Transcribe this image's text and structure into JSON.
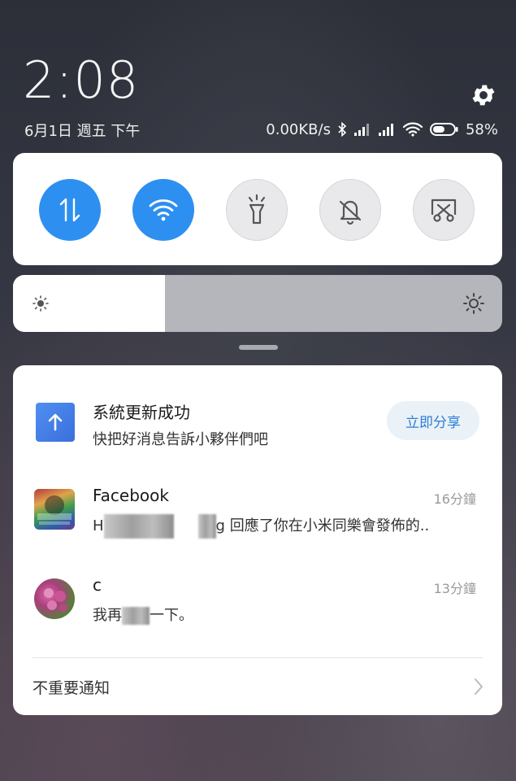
{
  "clock": {
    "time": "2:08",
    "date": "6月1日 週五 下午"
  },
  "status_bar": {
    "net_speed": "0.00KB/s",
    "battery_percent": "58%",
    "battery_level": 0.58,
    "icons": [
      "bluetooth-icon",
      "signal-icon",
      "signal-icon",
      "wifi-icon",
      "battery-icon"
    ]
  },
  "quick_settings": {
    "toggles": [
      {
        "name": "mobile-data",
        "icon": "data-transfer-icon",
        "active": true
      },
      {
        "name": "wifi",
        "icon": "wifi-icon",
        "active": true
      },
      {
        "name": "flashlight",
        "icon": "flashlight-icon",
        "active": false
      },
      {
        "name": "silent",
        "icon": "bell-off-icon",
        "active": false
      },
      {
        "name": "screenshot",
        "icon": "scissors-icon",
        "active": false
      }
    ]
  },
  "brightness": {
    "level": 0.31
  },
  "notifications": [
    {
      "title": "系統更新成功",
      "body": "快把好消息告訴小夥伴們吧",
      "action": "立即分享",
      "icon": "update-arrow-icon"
    },
    {
      "title": "Facebook",
      "body_prefix": "H",
      "body_mid": "g",
      "body": "回應了你在小米同樂會發佈的..",
      "time": "16分鐘",
      "icon": "facebook-page-avatar"
    },
    {
      "title": "c",
      "body": "我再",
      "body_end": "一下。",
      "time": "13分鐘",
      "icon": "flower-avatar"
    }
  ],
  "footer": {
    "label": "不重要通知"
  },
  "colors": {
    "accent": "#2d8ff0",
    "share_text": "#2d7fd6"
  }
}
